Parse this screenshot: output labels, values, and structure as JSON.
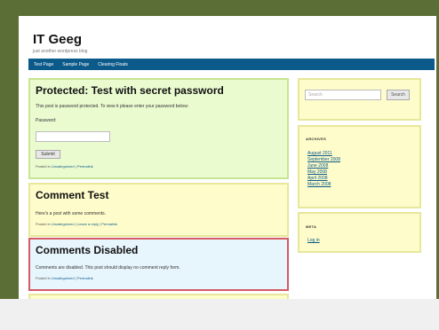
{
  "site": {
    "title": "IT Geeg",
    "description": "just another wordpress blog"
  },
  "nav": {
    "items": [
      "Test Page",
      "Sample Page",
      "Clearing Floats"
    ]
  },
  "posts": [
    {
      "title": "Protected: Test with secret password",
      "body": "This post is password protected. To view it please enter your password below:",
      "password_label": "Password:",
      "submit_label": "Submit",
      "meta_prefix": "Posted in",
      "category": "Uncategorized",
      "sep": "|",
      "permalink": "Permalink"
    },
    {
      "title": "Comment Test",
      "body": "Here's a post with some comments.",
      "meta_prefix": "Posted in",
      "category": "Uncategorized",
      "sep": "|",
      "reply": "Leave a reply",
      "permalink": "Permalink"
    },
    {
      "title": "Comments Disabled",
      "body": "Comments are disabled. This post should display no comment reply form.",
      "meta_prefix": "Posted in",
      "category": "Uncategorized",
      "sep": "|",
      "permalink": "Permalink"
    }
  ],
  "sidebar": {
    "search": {
      "placeholder": "Search",
      "button_label": "Search"
    },
    "archives": {
      "title": "ARCHIVES",
      "links": [
        "August 2011",
        "September 2008",
        "June 2008",
        "May 2008",
        "April 2008",
        "March 2008"
      ]
    },
    "meta": {
      "title": "META",
      "links": [
        "Log in"
      ]
    }
  },
  "colors": {
    "frame": "#5b6e36",
    "nav": "#0c5a8a",
    "post_green": "#eafbd0",
    "post_yellow": "#fdfcca",
    "post_blue": "#e7f5fc",
    "border_red": "#d55a62"
  }
}
